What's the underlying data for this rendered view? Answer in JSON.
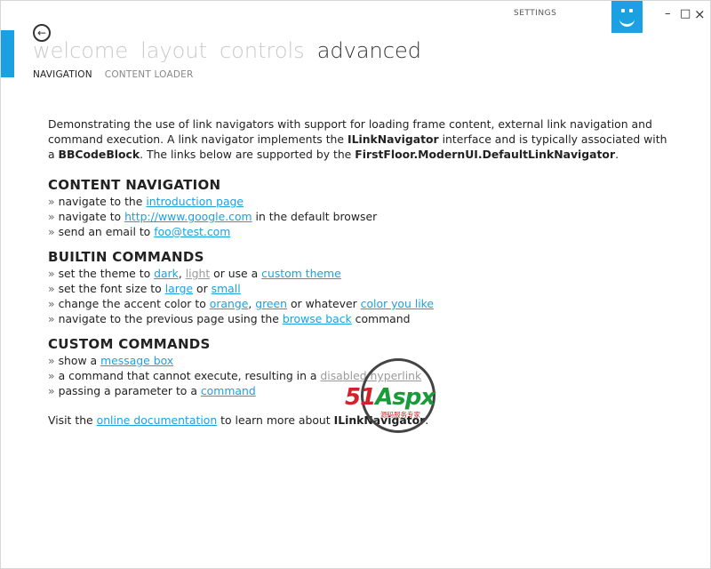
{
  "window": {
    "settings_label": "SETTINGS",
    "minimize": "–",
    "maximize": "□",
    "close": "×",
    "accent_color": "#1ba1e2"
  },
  "menu": {
    "items": [
      "welcome",
      "layout",
      "controls",
      "advanced"
    ],
    "active_index": 3
  },
  "submenu": {
    "items": [
      "NAVIGATION",
      "CONTENT LOADER"
    ],
    "active_index": 0
  },
  "content": {
    "intro": {
      "t1": "Demonstrating the use of link navigators with support for loading frame content, external link navigation and command execution. A link navigator implements the ",
      "b1": "ILinkNavigator",
      "t2": " interface and is typically associated with a ",
      "b2": "BBCodeBlock",
      "t3": ". The links below are supported by the ",
      "b3": "FirstFloor.ModernUI.DefaultLinkNavigator",
      "t4": "."
    },
    "bullet": "»",
    "content_navigation": {
      "title": "CONTENT NAVIGATION",
      "l1": {
        "pre": "navigate to the ",
        "link": "introduction page"
      },
      "l2": {
        "pre": "navigate to ",
        "link": "http://www.google.com",
        "post": " in the default browser"
      },
      "l3": {
        "pre": "send an email to ",
        "link": "foo@test.com"
      }
    },
    "builtin_commands": {
      "title": "BUILTIN COMMANDS",
      "l1": {
        "pre": "set the theme to ",
        "link1": "dark",
        "sep1": ", ",
        "link2": "light",
        "mid": " or use a ",
        "link3": "custom theme"
      },
      "l2": {
        "pre": "set the font size to ",
        "link1": "large",
        "mid": " or ",
        "link2": "small"
      },
      "l3": {
        "pre": "change the accent color to ",
        "link1": "orange",
        "sep1": ", ",
        "link2": "green",
        "mid": " or whatever ",
        "link3": "color you like"
      },
      "l4": {
        "pre": "navigate to the previous page using the ",
        "link": "browse back",
        "post": " command"
      }
    },
    "custom_commands": {
      "title": "CUSTOM COMMANDS",
      "l1": {
        "pre": "show a ",
        "link": "message box"
      },
      "l2": {
        "pre": "a command that cannot execute, resulting in a ",
        "link": "disabled hyperlink"
      },
      "l3": {
        "pre": "passing a parameter to a ",
        "link": "command"
      }
    },
    "footer": {
      "pre": "Visit the ",
      "link": "online documentation",
      "mid": " to learn more about ",
      "bold": "ILinkNavigator",
      "post": "."
    }
  },
  "watermark": {
    "brand_51": "51",
    "brand_aspx": "Aspx",
    "tagline": "源码服务专家",
    "red": "#d2232a",
    "green": "#1a9b3a"
  }
}
